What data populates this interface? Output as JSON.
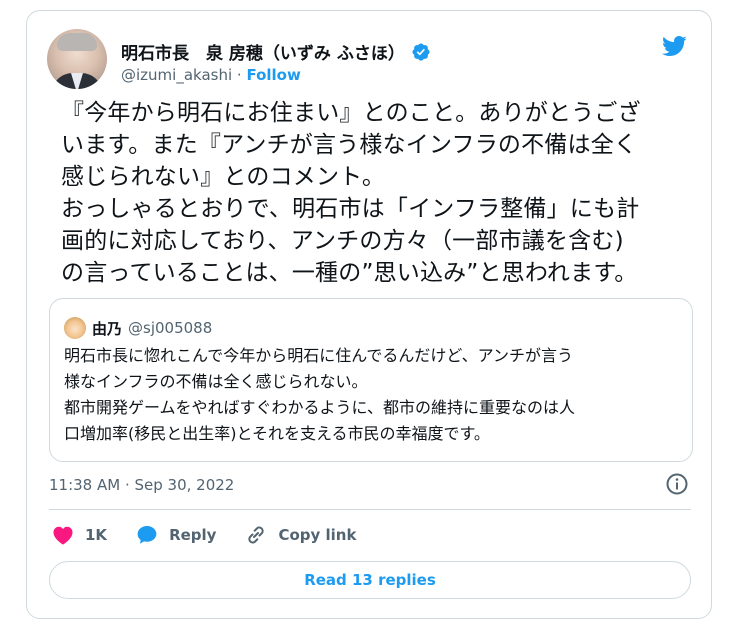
{
  "author": {
    "display_name": "明石市長　泉 房穂（いずみ ふさほ）",
    "handle": "@izumi_akashi",
    "separator": " · ",
    "follow_label": "Follow"
  },
  "tweet": {
    "text": "『今年から明石にお住まい』とのこと。ありがとうござ\nいます。また『アンチが言う様なインフラの不備は全く\n感じられない』とのコメント。\nおっしゃるとおりで、明石市は「インフラ整備」にも計\n画的に対応しており、アンチの方々（一部市議を含む)\nの言っていることは、一種の”思い込み”と思われます。"
  },
  "quoted": {
    "name": "由乃",
    "handle": "@sj005088",
    "text": "明石市長に惚れこんで今年から明石に住んでるんだけど、アンチが言う\n様なインフラの不備は全く感じられない。\n都市開発ゲームをやればすぐわかるように、都市の維持に重要なのは人\n口増加率(移民と出生率)とそれを支える市民の幸福度です。"
  },
  "timestamp": "11:38 AM · Sep 30, 2022",
  "actions": {
    "like_count": "1K",
    "reply_label": "Reply",
    "copy_label": "Copy link"
  },
  "read_replies_label": "Read 13 replies",
  "colors": {
    "accent": "#1d9bf0",
    "like": "#f91880",
    "muted": "#536471",
    "border": "#cfd9de"
  },
  "icons": {
    "brand": "twitter-bird-icon",
    "verified": "verified-badge-icon",
    "info": "info-icon",
    "like": "heart-icon",
    "reply": "speech-bubble-icon",
    "copy": "link-icon"
  }
}
